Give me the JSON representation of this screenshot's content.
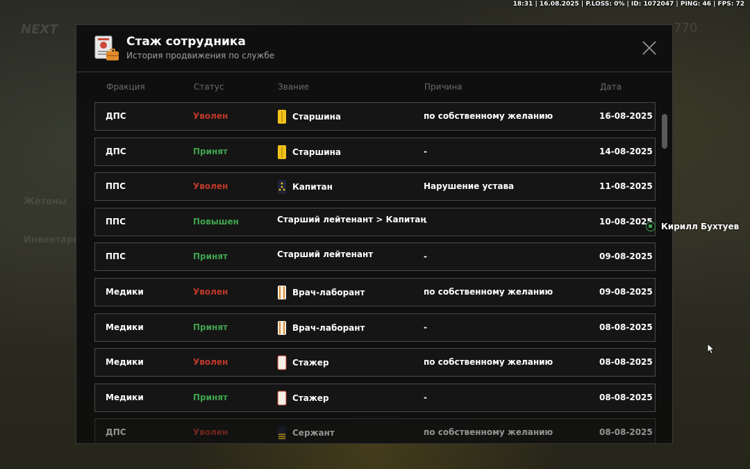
{
  "status_bar": "18:31 | 16.08.2025 | P.LOSS: 0% | ID: 1072047 | PING: 46 | FPS: 72",
  "background": {
    "logo": "NEXT",
    "tokens": "Жетоны",
    "inventory": "Инвентарь",
    "money": "770"
  },
  "modal": {
    "title": "Стаж сотрудника",
    "subtitle": "История продвижения по службе",
    "icon": "id-card-briefcase-icon",
    "columns": {
      "faction": "Фракция",
      "status": "Статус",
      "rank": "Звание",
      "reason": "Причина",
      "date": "Дата"
    },
    "rows": [
      {
        "faction": "ДПС",
        "status": "Уволен",
        "status_type": "fired",
        "rank": "Старшина",
        "rank_icon": "yellow-strap-icon",
        "reason": "по собственному желанию",
        "date": "16-08-2025"
      },
      {
        "faction": "ДПС",
        "status": "Принят",
        "status_type": "hired",
        "rank": "Старшина",
        "rank_icon": "yellow-strap-icon",
        "reason": "-",
        "date": "14-08-2025"
      },
      {
        "faction": "ППС",
        "status": "Уволен",
        "status_type": "fired",
        "rank": "Капитан",
        "rank_icon": "dark-strap-stars-icon",
        "reason": "Нарушение устава",
        "date": "11-08-2025"
      },
      {
        "faction": "ППС",
        "status": "Повышен",
        "status_type": "promoted",
        "rank": "Старший лейтенант > Капитан",
        "rank_icon": "",
        "reason": "-",
        "date": "10-08-2025"
      },
      {
        "faction": "ППС",
        "status": "Принят",
        "status_type": "hired",
        "rank": "Старший лейтенант",
        "rank_icon": "",
        "reason": "-",
        "date": "09-08-2025"
      },
      {
        "faction": "Медики",
        "status": "Уволен",
        "status_type": "fired",
        "rank": "Врач-лаборант",
        "rank_icon": "white-strap-orange-icon",
        "reason": "по собственному желанию",
        "date": "09-08-2025"
      },
      {
        "faction": "Медики",
        "status": "Принят",
        "status_type": "hired",
        "rank": "Врач-лаборант",
        "rank_icon": "white-strap-orange-icon",
        "reason": "-",
        "date": "08-08-2025"
      },
      {
        "faction": "Медики",
        "status": "Уволен",
        "status_type": "fired",
        "rank": "Стажер",
        "rank_icon": "white-strap-red-icon",
        "reason": "по собственному желанию",
        "date": "08-08-2025"
      },
      {
        "faction": "Медики",
        "status": "Принят",
        "status_type": "hired",
        "rank": "Стажер",
        "rank_icon": "white-strap-red-icon",
        "reason": "-",
        "date": "08-08-2025"
      },
      {
        "faction": "ДПС",
        "status": "Уволен",
        "status_type": "fired",
        "rank": "Сержант",
        "rank_icon": "dark-strap-yellow-stripes-icon",
        "reason": "по собственному желанию",
        "date": "08-08-2025"
      }
    ]
  },
  "voice": {
    "name": "Кирилл Бухтуев",
    "icon": "voice-speaker-icon"
  },
  "colors": {
    "fired": "#c0392b",
    "hired": "#3fa34d",
    "promoted": "#3fa34d"
  }
}
